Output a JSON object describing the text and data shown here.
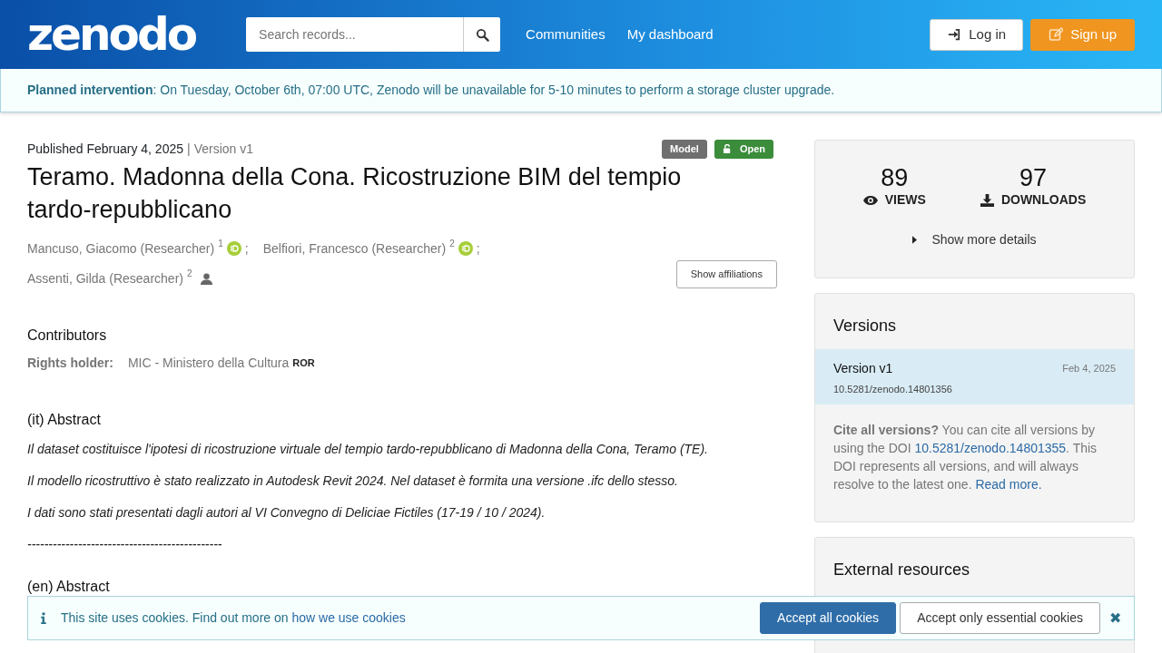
{
  "header": {
    "logo": "zenodo",
    "search": {
      "placeholder": "Search records..."
    },
    "nav": [
      "Communities",
      "My dashboard"
    ],
    "login": "Log in",
    "signup": "Sign up"
  },
  "banner": {
    "text": "**Planned intervention**: On Tuesday, October 6th, 07:00 UTC, Zenodo will be unavailable for 5-10 minutes to perform a storage cluster upgrade."
  },
  "record": {
    "published": "Published February 4, 2025",
    "version_separator": "|",
    "version": "Version v1",
    "badges": [
      {
        "label": "Model",
        "kind": "type"
      },
      {
        "label": "Open",
        "kind": "access"
      }
    ],
    "title": "Teramo. Madonna della Cona. Ricostruzione BIM del tempio tardo-repubblicano",
    "creators": [
      {
        "name": "Mancuso, Giacomo (Researcher)",
        "aff": "1",
        "orcid": true,
        "separator": ";"
      },
      {
        "name": "Belfiori, Francesco (Researcher)",
        "aff": "2",
        "orcid": true,
        "separator": ";"
      },
      {
        "name": "Assenti, Gilda (Researcher)",
        "aff": "2",
        "orcid": false
      }
    ],
    "show_affiliations": "Show affiliations",
    "contributors_title": "Contributors",
    "rights_label": "Rights holder:",
    "rights_value": "MIC - Ministero della Cultura",
    "ror": "ROR",
    "it_title": "(it) Abstract",
    "it_paragraphs": [
      "Il dataset costituisce l'ipotesi di ricostruzione virtuale del tempio tardo-repubblicano di Madonna della Cona, Teramo (TE).",
      "Il modello ricostruttivo è stato realizzato in Autodesk Revit 2024. Nel dataset è formita una versione .ifc dello stesso.",
      "I dati sono stati presentati dagli autori al VI Convegno di Deliciae Fictiles (17-19 / 10 / 2024).",
      "----------------------------------------------"
    ],
    "en_title": "(en) Abstract"
  },
  "sidebar": {
    "views": "89",
    "views_label": "VIEWS",
    "downloads": "97",
    "downloads_label": "DOWNLOADS",
    "more": "Show more details",
    "versions_title": "Versions",
    "versions": [
      {
        "label": "Version v1",
        "date": "Feb 4, 2025",
        "doi": "10.5281/zenodo.14801356",
        "selected": true
      }
    ],
    "cite_bold": "Cite all versions?",
    "cite_text1": "You can cite all versions by using the DOI",
    "cite_doi": "10.5281/zenodo.14801355",
    "cite_text2": ". This DOI represents all versions, and will always resolve to the latest one.",
    "cite_link": "Read more.",
    "external_title": "External resources"
  },
  "cookies": {
    "text": "This site uses cookies. Find out more on",
    "link": "how we use cookies",
    "accept_all": "Accept all cookies",
    "accept_essential": "Accept only essential cookies",
    "close": "✖"
  }
}
